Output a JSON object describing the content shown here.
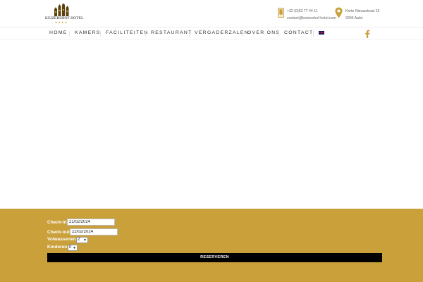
{
  "brand": {
    "name": "KEIZERSHOF HOTEL",
    "stars": "★★★★",
    "accent_color": "#c9a03a"
  },
  "contact": {
    "phone": "+32 (0)53 77 44 11",
    "email": "contact@keizershof-hotel.com",
    "address_line1": "Korte Nieuwstraat 15",
    "address_line2": "9300 Aalst",
    "phone_icon": "mobile-phone-icon",
    "address_icon": "map-pin-icon"
  },
  "nav": {
    "items": [
      "HOME",
      "KAMERS",
      "FACILITEITEN",
      "RESTAURANT",
      "VERGADERZALEN",
      "OVER ONS",
      "CONTACT"
    ],
    "language_icon": "uk-flag-icon",
    "social_icon": "facebook-icon"
  },
  "booking": {
    "checkin_label": "Check-in",
    "checkin_value": "21/02/2024",
    "checkout_label": "Check-out",
    "checkout_value": "22/02/2024",
    "adults_label": "Volwassenen",
    "adults_value": "2",
    "children_label": "Kinderen",
    "children_value": "0",
    "submit_label": "RESERVEREN"
  }
}
